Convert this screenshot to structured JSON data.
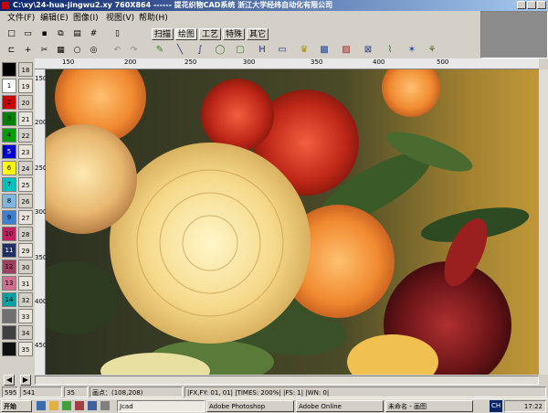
{
  "title": "C:\\xy\\24-hua-jingwu2.xy  760X864  ------  提花织物CAD系统  浙江大学经纬自动化有限公司",
  "menu": [
    "文件(F)",
    "编辑(E)",
    "图像(I)",
    "视图(V)",
    "帮助(H)"
  ],
  "tabs": [
    "扫描",
    "绘图",
    "工艺",
    "特殊",
    "其它"
  ],
  "ruler_top": [
    "150",
    "200",
    "250",
    "300",
    "350",
    "400",
    "450",
    "500"
  ],
  "ruler_left": [
    "150",
    "200",
    "250",
    "300",
    "350",
    "400",
    "450"
  ],
  "palette_numbers": [
    "18",
    "19",
    "20",
    "21",
    "22",
    "23",
    "24",
    "25",
    "26",
    "27",
    "28",
    "29",
    "30",
    "31",
    "32",
    "33",
    "34",
    "35"
  ],
  "palette_left_numbers": [
    "1",
    "2",
    "3",
    "4",
    "5",
    "6",
    "7",
    "8",
    "9",
    "10",
    "11",
    "12",
    "13",
    "14"
  ],
  "colors": {
    "palette_left": [
      "#000000",
      "#ffffff",
      "#cc0000",
      "#008000",
      "#00a000",
      "#0000cc",
      "#ffff00",
      "#00c0c0",
      "#7fb6e0",
      "#3d7fd0",
      "#c02060",
      "#203060",
      "#a04060",
      "#d07090",
      "#00a0a0",
      "#707070",
      "#404040",
      "#101010"
    ],
    "palette_right": [
      "#d05050",
      "#4060a0",
      "#808080",
      "#b00000",
      "#600060",
      "#203060",
      "#c0a080",
      "#e0e0e0",
      "#103080",
      "#7090c0",
      "#a04040",
      "#404040",
      "#505050",
      "#60a020",
      "#304060",
      "#707070",
      "#404040",
      "#202020"
    ]
  },
  "status": {
    "coord_x": "595",
    "coord_y": "541",
    "field3": "35",
    "point": "画点：(108,208)",
    "fx": "|FX,FY: 01, 01|  |TIMES: 200%|  |FS: 1|  |WN:  0|"
  },
  "taskbar": {
    "start": "开始",
    "tasks": [
      "Jcad",
      "Adobe Photoshop",
      "Adobe Online",
      "未命名 - 画图"
    ],
    "lang": "CH",
    "clock": "17:22"
  }
}
